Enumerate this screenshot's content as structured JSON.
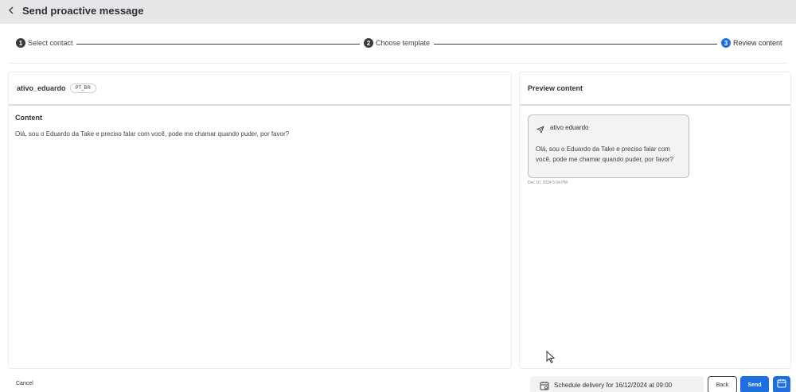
{
  "header": {
    "title": "Send proactive message"
  },
  "stepper": {
    "steps": [
      {
        "number": "1",
        "label": "Select contact"
      },
      {
        "number": "2",
        "label": "Choose template"
      },
      {
        "number": "3",
        "label": "Review content"
      }
    ]
  },
  "template": {
    "name": "ativo_eduardo",
    "language": "PT_BR",
    "content_label": "Content",
    "content_text": "Olá, sou o Eduardo da Take e preciso falar com você, pode me chamar quando puder, por favor?"
  },
  "preview": {
    "title": "Preview content",
    "sender": "ativo eduardo",
    "message": "Olá, sou o Eduardo da Take e preciso falar com você, pode me chamar quando puder, por favor?",
    "timestamp": "Dec 10, 2024 5:34 PM"
  },
  "footer": {
    "cancel_label": "Cancel",
    "schedule_label": "Schedule delivery for 16/12/2024 at 09:00",
    "back_label": "Back",
    "send_label": "Send"
  },
  "colors": {
    "accent": "#1f6fe0",
    "step_inactive": "#3a3a3c"
  },
  "icons": {
    "back": "chevron-left-icon",
    "send": "paper-plane-icon",
    "calendar": "calendar-icon",
    "cursor": "mouse-cursor-icon"
  }
}
